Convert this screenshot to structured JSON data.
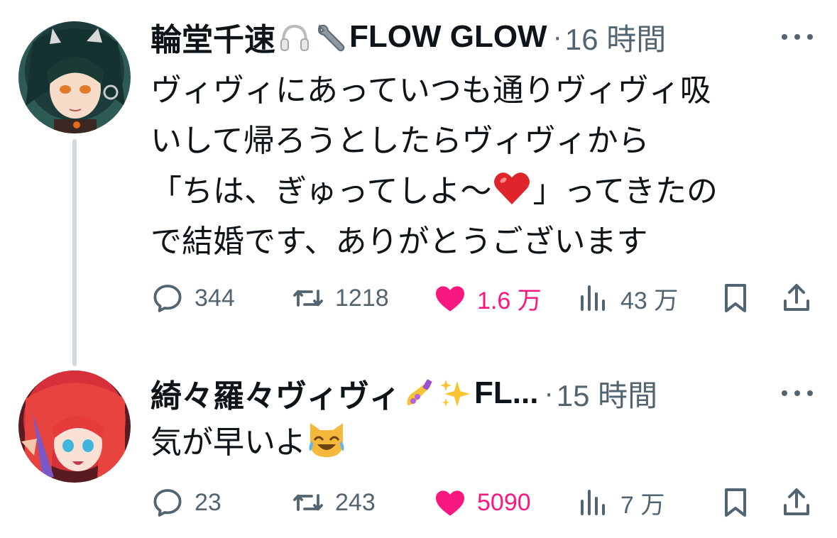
{
  "tweets": [
    {
      "author_name": "輪堂千速",
      "handle_suffix": "FLOW GLOW",
      "time": "16 時間",
      "text_lines": [
        "ヴィヴィにあっていつも通りヴィヴィ吸",
        "いして帰ろうとしたらヴィヴィから",
        "「ちは、ぎゅってしよ〜",
        "」ってきたの",
        "で結婚です、ありがとうございます"
      ],
      "stats": {
        "replies": "344",
        "retweets": "1218",
        "likes": "1.6 万",
        "views": "43 万"
      },
      "icons": [
        "headphones-icon",
        "wrench-icon",
        "red-heart-icon"
      ],
      "liked": true
    },
    {
      "author_name": "綺々羅々ヴィヴィ",
      "handle_suffix": "FL...",
      "time": "15 時間",
      "text_lines": [
        "気が早いよ"
      ],
      "stats": {
        "replies": "23",
        "retweets": "243",
        "likes": "5090",
        "views": "7 万"
      },
      "icons": [
        "nail-polish-icon",
        "sparkles-icon",
        "cat-tears-of-joy-icon"
      ],
      "liked": true
    }
  ],
  "colors": {
    "text": "#0f1419",
    "secondary": "#536471",
    "like": "#f91880",
    "thread_line": "#cfd9de"
  }
}
